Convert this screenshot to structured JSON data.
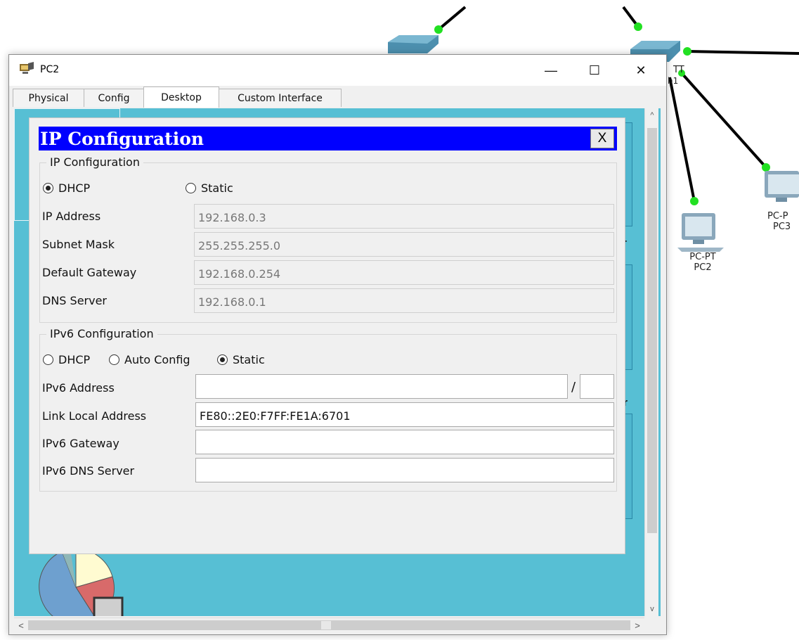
{
  "window": {
    "title": "PC2",
    "minimize_glyph": "—",
    "maximize_glyph": "☐",
    "close_glyph": "✕"
  },
  "tabs": [
    {
      "label": "Physical"
    },
    {
      "label": "Config"
    },
    {
      "label": "Desktop"
    },
    {
      "label": "Custom Interface"
    }
  ],
  "topology": {
    "pc2_label_line1": "PC-PT",
    "pc2_label_line2": "PC2",
    "pc3_label_line1": "PC-P",
    "pc3_label_line2": "PC3",
    "switch_label_fragment_1": "TT",
    "switch_label_fragment_2": "h1",
    "link_dot_color": "#00e000"
  },
  "behind": {
    "text_1": "r",
    "text_2": "or",
    "text_3": "l"
  },
  "ip_config": {
    "title": "IP Configuration",
    "close_label": "X",
    "ipv4": {
      "legend": "IP Configuration",
      "dhcp_label": "DHCP",
      "static_label": "Static",
      "mode": "DHCP",
      "ip_address_label": "IP Address",
      "ip_address": "192.168.0.3",
      "subnet_mask_label": "Subnet Mask",
      "subnet_mask": "255.255.255.0",
      "default_gateway_label": "Default Gateway",
      "default_gateway": "192.168.0.254",
      "dns_server_label": "DNS Server",
      "dns_server": "192.168.0.1"
    },
    "ipv6": {
      "legend": "IPv6 Configuration",
      "dhcp_label": "DHCP",
      "auto_label": "Auto Config",
      "static_label": "Static",
      "mode": "Static",
      "address_label": "IPv6 Address",
      "address": "",
      "prefix_separator": "/",
      "prefix": "",
      "link_local_label": "Link Local Address",
      "link_local": "FE80::2E0:F7FF:FE1A:6701",
      "gateway_label": "IPv6 Gateway",
      "gateway": "",
      "dns_label": "IPv6 DNS Server",
      "dns": ""
    }
  },
  "scroll": {
    "up_glyph": "^",
    "down_glyph": "v",
    "left_glyph": "<",
    "right_glyph": ">"
  },
  "colors": {
    "dialog_header": "#0000ff",
    "desktop_bg": "#57bfd4"
  }
}
